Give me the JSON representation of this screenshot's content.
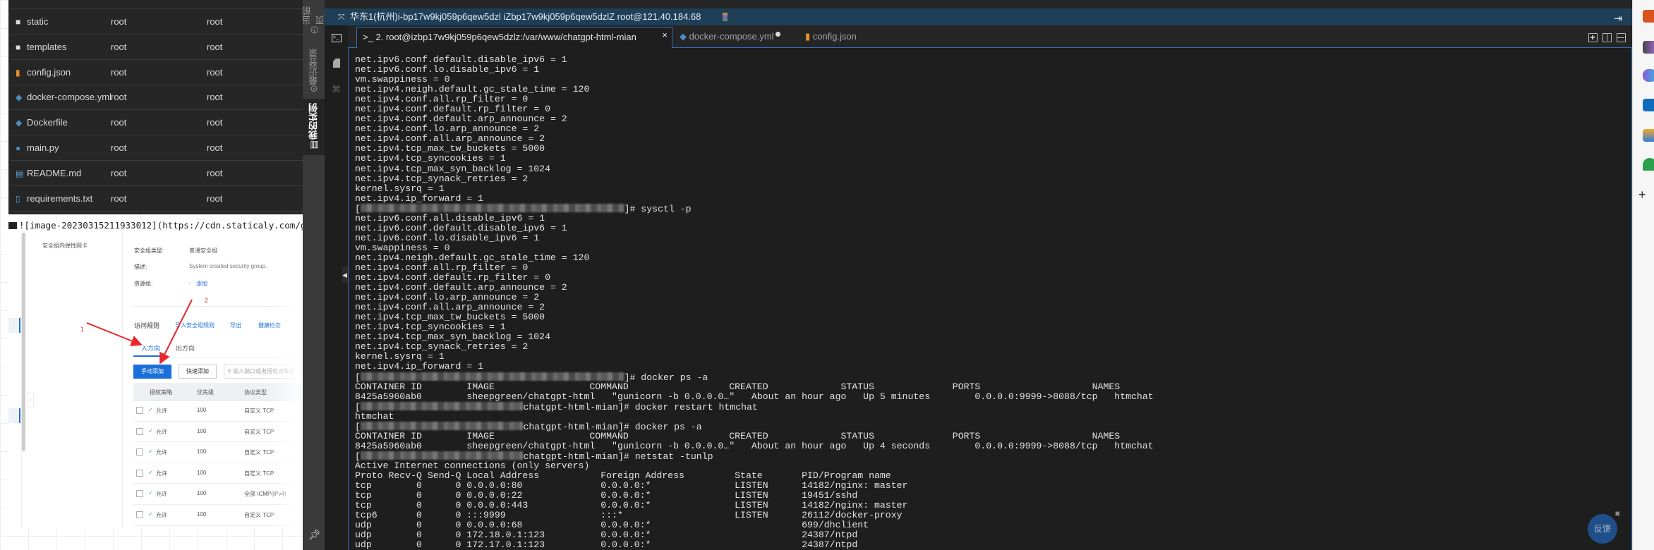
{
  "file_list": {
    "rows": [
      {
        "icon": "folder-icon",
        "name": "static",
        "owner": "root",
        "group": "root"
      },
      {
        "icon": "folder-icon",
        "name": "templates",
        "owner": "root",
        "group": "root"
      },
      {
        "icon": "json-file-icon",
        "name": "config.json",
        "owner": "root",
        "group": "root"
      },
      {
        "icon": "docker-icon",
        "name": "docker-compose.yml",
        "owner": "root",
        "group": "root"
      },
      {
        "icon": "docker-icon",
        "name": "Dockerfile",
        "owner": "root",
        "group": "root"
      },
      {
        "icon": "python-icon",
        "name": "main.py",
        "owner": "root",
        "group": "root"
      },
      {
        "icon": "markdown-icon",
        "name": "README.md",
        "owner": "root",
        "group": "root"
      },
      {
        "icon": "text-file-icon",
        "name": "requirements.txt",
        "owner": "root",
        "group": "root"
      }
    ]
  },
  "markdown_line": "![image-20230315211933012](https://cdn.staticaly.com/gh",
  "embedded_screenshot": {
    "left_item": "安全组内弹性网卡",
    "type_label": "安全组类型:",
    "type_value": "普通安全组",
    "desc_label": "描述:",
    "desc_value": "System created security group.",
    "rg_label": "资源组:",
    "rg_dash": "-",
    "rg_add": "添加",
    "access_rules": "访问规则",
    "import_rules": "导入安全组规则",
    "export": "导出",
    "health_check": "健康检查",
    "tab_in": "入方向",
    "tab_out": "出方向",
    "manual_add": "手动添加",
    "quick_add": "快速添加",
    "search_placeholder": "输入端口或者授权对象进",
    "headers": [
      "授权策略",
      "优先级",
      "协议类型"
    ],
    "rows": [
      {
        "policy": "允许",
        "priority": "100",
        "protocol": "自定义 TCP"
      },
      {
        "policy": "允许",
        "priority": "100",
        "protocol": "自定义 TCP"
      },
      {
        "policy": "允许",
        "priority": "100",
        "protocol": "自定义 TCP"
      },
      {
        "policy": "允许",
        "priority": "100",
        "protocol": "自定义 TCP"
      },
      {
        "policy": "允许",
        "priority": "100",
        "protocol": "全部 ICMP(IPv4)"
      },
      {
        "policy": "允许",
        "priority": "100",
        "protocol": "自定义 TCP"
      }
    ],
    "annotation_1": "1",
    "annotation_2": "2",
    "arrow_color": "#e8262b",
    "primary_color": "#1a6fdb"
  },
  "sidebar": {
    "current_page": "当前页",
    "recent_login": "最近登录",
    "my_instances": "我的实例"
  },
  "titlebar": {
    "text": "华东1(杭州)i-bp17w9kj059p6qew5dzl   iZbp17w9kj059p6qew5dzlZ   root@121.40.184.68"
  },
  "tabs": [
    {
      "label": "2. root@izbp17w9kj059p6qew5dzlz:/var/www/chatgpt-html-mian",
      "active": true
    },
    {
      "label": "docker-compose.yml",
      "modified": true
    },
    {
      "label": "config.json"
    }
  ],
  "terminal": {
    "lines": [
      "net.ipv6.conf.default.disable_ipv6 = 1",
      "net.ipv6.conf.lo.disable_ipv6 = 1",
      "vm.swappiness = 0",
      "net.ipv4.neigh.default.gc_stale_time = 120",
      "net.ipv4.conf.all.rp_filter = 0",
      "net.ipv4.conf.default.rp_filter = 0",
      "net.ipv4.conf.default.arp_announce = 2",
      "net.ipv4.conf.lo.arp_announce = 2",
      "net.ipv4.conf.all.arp_announce = 2",
      "net.ipv4.tcp_max_tw_buckets = 5000",
      "net.ipv4.tcp_syncookies = 1",
      "net.ipv4.tcp_max_syn_backlog = 1024",
      "net.ipv4.tcp_synack_retries = 2",
      "kernel.sysrq = 1",
      "net.ipv4.ip_forward = 1",
      {
        "prompt": "[",
        "text": "]# sysctl -p"
      },
      "net.ipv6.conf.all.disable_ipv6 = 1",
      "net.ipv6.conf.default.disable_ipv6 = 1",
      "net.ipv6.conf.lo.disable_ipv6 = 1",
      "vm.swappiness = 0",
      "net.ipv4.neigh.default.gc_stale_time = 120",
      "net.ipv4.conf.all.rp_filter = 0",
      "net.ipv4.conf.default.rp_filter = 0",
      "net.ipv4.conf.default.arp_announce = 2",
      "net.ipv4.conf.lo.arp_announce = 2",
      "net.ipv4.conf.all.arp_announce = 2",
      "net.ipv4.tcp_max_tw_buckets = 5000",
      "net.ipv4.tcp_syncookies = 1",
      "net.ipv4.tcp_max_syn_backlog = 1024",
      "net.ipv4.tcp_synack_retries = 2",
      "kernel.sysrq = 1",
      "net.ipv4.ip_forward = 1",
      {
        "prompt": "[",
        "text": "]# docker ps -a"
      },
      "CONTAINER ID        IMAGE                 COMMAND                  CREATED             STATUS              PORTS                    NAMES",
      "8425a5960ab0        sheepgreen/chatgpt-html   \"gunicorn -b 0.0.0.0…\"   About an hour ago   Up 5 minutes        0.0.0.0:9999->8088/tcp   htmchat",
      {
        "prompt": "[",
        "text": "chatgpt-html-mian]# docker restart htmchat"
      },
      "htmchat",
      {
        "prompt": "[",
        "text": "chatgpt-html-mian]# docker ps -a"
      },
      "CONTAINER ID        IMAGE                 COMMAND                  CREATED             STATUS              PORTS                    NAMES",
      "8425a5960ab0        sheepgreen/chatgpt-html   \"gunicorn -b 0.0.0.0…\"   About an hour ago   Up 4 seconds        0.0.0.0:9999->8088/tcp   htmchat",
      {
        "prompt": "[",
        "text": "chatgpt-html-mian]# netstat -tunlp"
      },
      "Active Internet connections (only servers)",
      "Proto Recv-Q Send-Q Local Address           Foreign Address         State       PID/Program name",
      "tcp        0      0 0.0.0.0:80              0.0.0.0:*               LISTEN      14182/nginx: master",
      "tcp        0      0 0.0.0.0:22              0.0.0.0:*               LISTEN      19451/sshd",
      "tcp        0      0 0.0.0.0:443             0.0.0.0:*               LISTEN      14182/nginx: master",
      "tcp6       0      0 :::9999                 :::*                    LISTEN      26112/docker-proxy",
      "udp        0      0 0.0.0.0:68              0.0.0.0:*                           699/dhclient",
      "udp        0      0 172.18.0.1:123          0.0.0.0:*                           24387/ntpd",
      "udp        0      0 172.17.0.1:123          0.0.0.0:*                           24387/ntpd"
    ]
  },
  "feedback_button": "反馈",
  "colors": {
    "titlebar": "#1f3f58",
    "terminal_bg": "#1e1e1e",
    "accent": "#2f6fb8",
    "feedback": "#1f4f8a"
  }
}
